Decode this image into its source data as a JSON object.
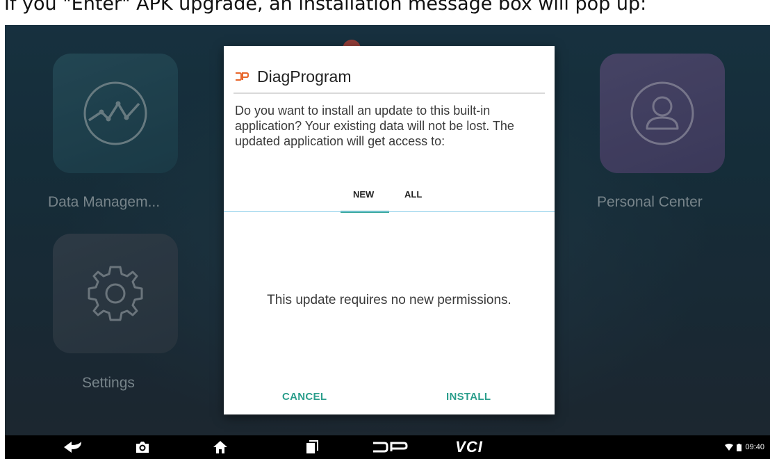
{
  "caption": "If you \"Enter\" APK upgrade, an installation message box will pop up:",
  "apps": {
    "data_management": "Data Managem...",
    "settings": "Settings",
    "personal_center": "Personal Center"
  },
  "dialog": {
    "title": "DiagProgram",
    "message": "Do you want to install an update to this built-in application? Your existing data will not be lost. The updated application will get access to:",
    "tabs": [
      "NEW",
      "ALL"
    ],
    "selected_tab": "NEW",
    "permissions_message": "This update requires no new permissions.",
    "cancel_label": "CANCEL",
    "install_label": "INSTALL"
  },
  "navbar": {
    "vci_label": "VCI",
    "time": "09:40"
  },
  "colors": {
    "accent": "#35a69a",
    "button_text": "#2b9e8c",
    "logo": "#e8662a"
  }
}
